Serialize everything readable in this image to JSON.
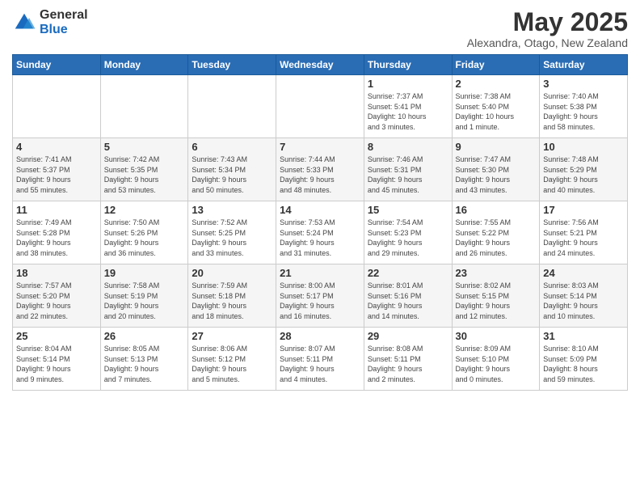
{
  "logo": {
    "general": "General",
    "blue": "Blue"
  },
  "header": {
    "month_title": "May 2025",
    "location": "Alexandra, Otago, New Zealand"
  },
  "days_of_week": [
    "Sunday",
    "Monday",
    "Tuesday",
    "Wednesday",
    "Thursday",
    "Friday",
    "Saturday"
  ],
  "weeks": [
    [
      {
        "day": "",
        "info": ""
      },
      {
        "day": "",
        "info": ""
      },
      {
        "day": "",
        "info": ""
      },
      {
        "day": "",
        "info": ""
      },
      {
        "day": "1",
        "info": "Sunrise: 7:37 AM\nSunset: 5:41 PM\nDaylight: 10 hours\nand 3 minutes."
      },
      {
        "day": "2",
        "info": "Sunrise: 7:38 AM\nSunset: 5:40 PM\nDaylight: 10 hours\nand 1 minute."
      },
      {
        "day": "3",
        "info": "Sunrise: 7:40 AM\nSunset: 5:38 PM\nDaylight: 9 hours\nand 58 minutes."
      }
    ],
    [
      {
        "day": "4",
        "info": "Sunrise: 7:41 AM\nSunset: 5:37 PM\nDaylight: 9 hours\nand 55 minutes."
      },
      {
        "day": "5",
        "info": "Sunrise: 7:42 AM\nSunset: 5:35 PM\nDaylight: 9 hours\nand 53 minutes."
      },
      {
        "day": "6",
        "info": "Sunrise: 7:43 AM\nSunset: 5:34 PM\nDaylight: 9 hours\nand 50 minutes."
      },
      {
        "day": "7",
        "info": "Sunrise: 7:44 AM\nSunset: 5:33 PM\nDaylight: 9 hours\nand 48 minutes."
      },
      {
        "day": "8",
        "info": "Sunrise: 7:46 AM\nSunset: 5:31 PM\nDaylight: 9 hours\nand 45 minutes."
      },
      {
        "day": "9",
        "info": "Sunrise: 7:47 AM\nSunset: 5:30 PM\nDaylight: 9 hours\nand 43 minutes."
      },
      {
        "day": "10",
        "info": "Sunrise: 7:48 AM\nSunset: 5:29 PM\nDaylight: 9 hours\nand 40 minutes."
      }
    ],
    [
      {
        "day": "11",
        "info": "Sunrise: 7:49 AM\nSunset: 5:28 PM\nDaylight: 9 hours\nand 38 minutes."
      },
      {
        "day": "12",
        "info": "Sunrise: 7:50 AM\nSunset: 5:26 PM\nDaylight: 9 hours\nand 36 minutes."
      },
      {
        "day": "13",
        "info": "Sunrise: 7:52 AM\nSunset: 5:25 PM\nDaylight: 9 hours\nand 33 minutes."
      },
      {
        "day": "14",
        "info": "Sunrise: 7:53 AM\nSunset: 5:24 PM\nDaylight: 9 hours\nand 31 minutes."
      },
      {
        "day": "15",
        "info": "Sunrise: 7:54 AM\nSunset: 5:23 PM\nDaylight: 9 hours\nand 29 minutes."
      },
      {
        "day": "16",
        "info": "Sunrise: 7:55 AM\nSunset: 5:22 PM\nDaylight: 9 hours\nand 26 minutes."
      },
      {
        "day": "17",
        "info": "Sunrise: 7:56 AM\nSunset: 5:21 PM\nDaylight: 9 hours\nand 24 minutes."
      }
    ],
    [
      {
        "day": "18",
        "info": "Sunrise: 7:57 AM\nSunset: 5:20 PM\nDaylight: 9 hours\nand 22 minutes."
      },
      {
        "day": "19",
        "info": "Sunrise: 7:58 AM\nSunset: 5:19 PM\nDaylight: 9 hours\nand 20 minutes."
      },
      {
        "day": "20",
        "info": "Sunrise: 7:59 AM\nSunset: 5:18 PM\nDaylight: 9 hours\nand 18 minutes."
      },
      {
        "day": "21",
        "info": "Sunrise: 8:00 AM\nSunset: 5:17 PM\nDaylight: 9 hours\nand 16 minutes."
      },
      {
        "day": "22",
        "info": "Sunrise: 8:01 AM\nSunset: 5:16 PM\nDaylight: 9 hours\nand 14 minutes."
      },
      {
        "day": "23",
        "info": "Sunrise: 8:02 AM\nSunset: 5:15 PM\nDaylight: 9 hours\nand 12 minutes."
      },
      {
        "day": "24",
        "info": "Sunrise: 8:03 AM\nSunset: 5:14 PM\nDaylight: 9 hours\nand 10 minutes."
      }
    ],
    [
      {
        "day": "25",
        "info": "Sunrise: 8:04 AM\nSunset: 5:14 PM\nDaylight: 9 hours\nand 9 minutes."
      },
      {
        "day": "26",
        "info": "Sunrise: 8:05 AM\nSunset: 5:13 PM\nDaylight: 9 hours\nand 7 minutes."
      },
      {
        "day": "27",
        "info": "Sunrise: 8:06 AM\nSunset: 5:12 PM\nDaylight: 9 hours\nand 5 minutes."
      },
      {
        "day": "28",
        "info": "Sunrise: 8:07 AM\nSunset: 5:11 PM\nDaylight: 9 hours\nand 4 minutes."
      },
      {
        "day": "29",
        "info": "Sunrise: 8:08 AM\nSunset: 5:11 PM\nDaylight: 9 hours\nand 2 minutes."
      },
      {
        "day": "30",
        "info": "Sunrise: 8:09 AM\nSunset: 5:10 PM\nDaylight: 9 hours\nand 0 minutes."
      },
      {
        "day": "31",
        "info": "Sunrise: 8:10 AM\nSunset: 5:09 PM\nDaylight: 8 hours\nand 59 minutes."
      }
    ]
  ]
}
